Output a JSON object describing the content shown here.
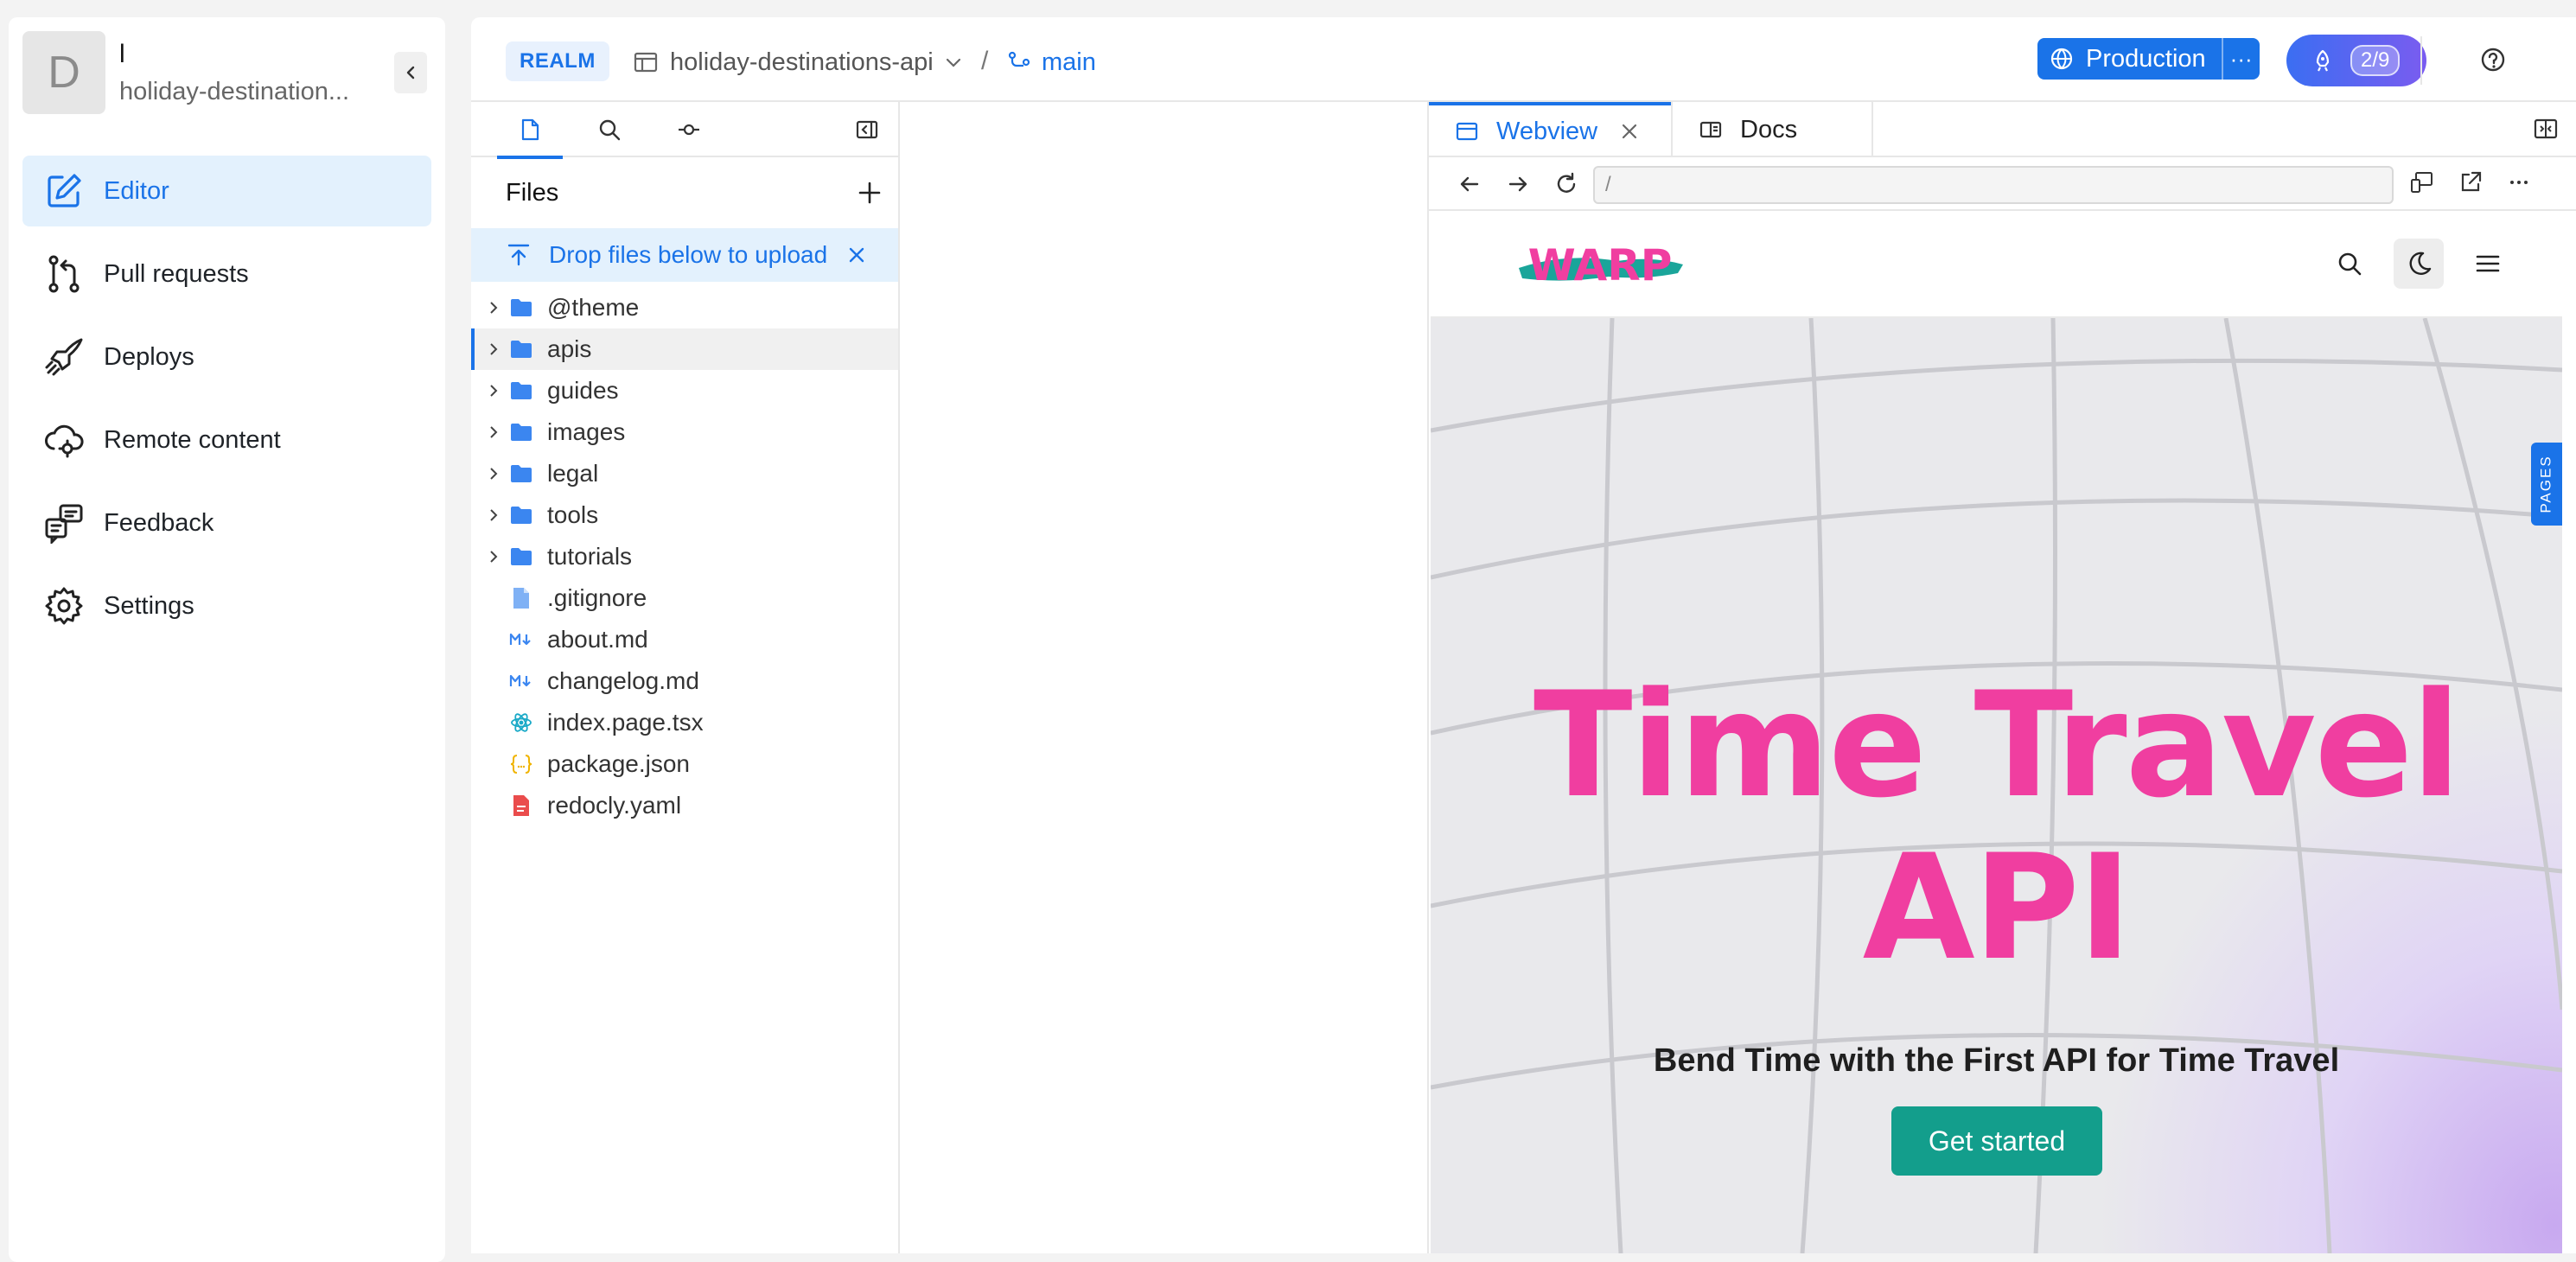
{
  "sidebar": {
    "avatar_letter": "D",
    "workspace_name": "l",
    "project_name": "holiday-destination...",
    "items": [
      {
        "label": "Editor",
        "icon": "edit-icon",
        "active": true
      },
      {
        "label": "Pull requests",
        "icon": "pull-request-icon"
      },
      {
        "label": "Deploys",
        "icon": "rocket-icon"
      },
      {
        "label": "Remote content",
        "icon": "cloud-gear-icon"
      },
      {
        "label": "Feedback",
        "icon": "feedback-icon"
      },
      {
        "label": "Settings",
        "icon": "gear-icon"
      }
    ]
  },
  "topbar": {
    "realm_badge": "REALM",
    "repo_name": "holiday-destinations-api",
    "separator": "/",
    "branch": "main",
    "environment": "Production",
    "environment_more": "···",
    "deploy_count": "2/9"
  },
  "files": {
    "header": "Files",
    "drop_message": "Drop files below to upload",
    "tree": [
      {
        "name": "@theme",
        "type": "folder"
      },
      {
        "name": "apis",
        "type": "folder",
        "selected": true
      },
      {
        "name": "guides",
        "type": "folder"
      },
      {
        "name": "images",
        "type": "folder"
      },
      {
        "name": "legal",
        "type": "folder"
      },
      {
        "name": "tools",
        "type": "folder"
      },
      {
        "name": "tutorials",
        "type": "folder"
      },
      {
        "name": ".gitignore",
        "type": "file",
        "icon": "file-icon"
      },
      {
        "name": "about.md",
        "type": "file",
        "icon": "markdown-icon"
      },
      {
        "name": "changelog.md",
        "type": "file",
        "icon": "markdown-icon"
      },
      {
        "name": "index.page.tsx",
        "type": "file",
        "icon": "react-icon"
      },
      {
        "name": "package.json",
        "type": "file",
        "icon": "json-icon"
      },
      {
        "name": "redocly.yaml",
        "type": "file",
        "icon": "yaml-icon"
      }
    ]
  },
  "preview": {
    "tabs": [
      {
        "label": "Webview",
        "active": true
      },
      {
        "label": "Docs"
      }
    ],
    "url_value": "/",
    "site": {
      "logo_text": "WARP",
      "hero_title_line1": "Time Travel",
      "hero_title_line2": "API",
      "hero_subtitle": "Bend Time with the First API for Time Travel",
      "cta_label": "Get started"
    },
    "pages_tab_label": "PAGES"
  },
  "colors": {
    "accent": "#1a73e8",
    "hero_title": "#f03ea0",
    "cta": "#139e8c"
  }
}
